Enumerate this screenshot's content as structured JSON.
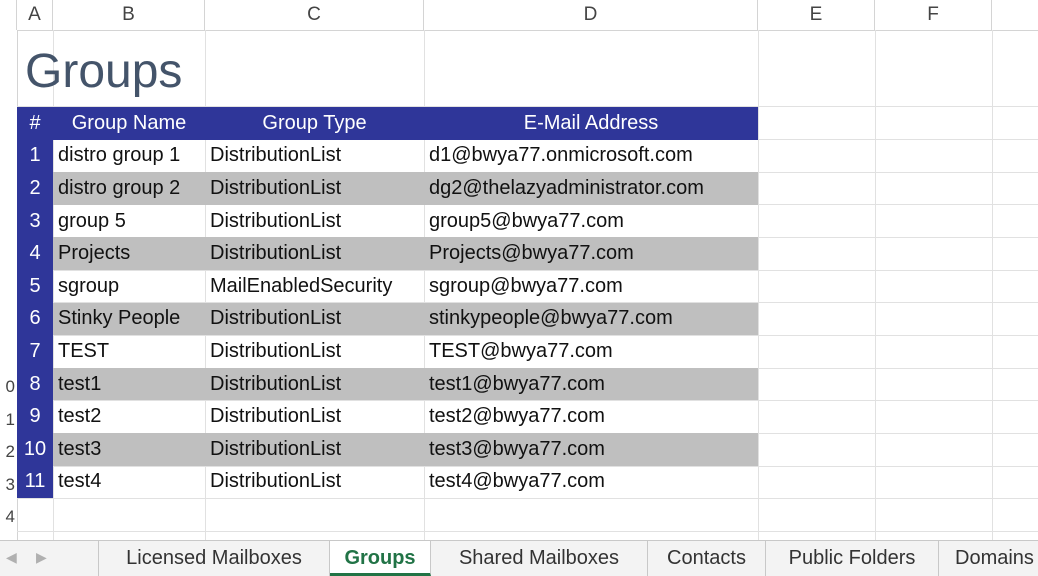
{
  "columns": [
    "A",
    "B",
    "C",
    "D",
    "E",
    "F"
  ],
  "row_numbers": [
    "",
    "",
    "",
    "",
    "",
    "",
    "",
    "",
    "",
    "0",
    "1",
    "2",
    "3",
    "4",
    ""
  ],
  "title": "Groups",
  "table": {
    "headers": {
      "num": "#",
      "name": "Group Name",
      "type": "Group Type",
      "mail": "E-Mail Address"
    },
    "rows": [
      {
        "num": "1",
        "name": "distro group 1",
        "type": "DistributionList",
        "mail": "d1@bwya77.onmicrosoft.com"
      },
      {
        "num": "2",
        "name": "distro group 2",
        "type": "DistributionList",
        "mail": "dg2@thelazyadministrator.com"
      },
      {
        "num": "3",
        "name": "group 5",
        "type": "DistributionList",
        "mail": "group5@bwya77.com"
      },
      {
        "num": "4",
        "name": "Projects",
        "type": "DistributionList",
        "mail": "Projects@bwya77.com"
      },
      {
        "num": "5",
        "name": "sgroup",
        "type": "MailEnabledSecurity",
        "mail": "sgroup@bwya77.com"
      },
      {
        "num": "6",
        "name": "Stinky People",
        "type": "DistributionList",
        "mail": "stinkypeople@bwya77.com"
      },
      {
        "num": "7",
        "name": "TEST",
        "type": "DistributionList",
        "mail": "TEST@bwya77.com"
      },
      {
        "num": "8",
        "name": "test1",
        "type": "DistributionList",
        "mail": "test1@bwya77.com"
      },
      {
        "num": "9",
        "name": "test2",
        "type": "DistributionList",
        "mail": "test2@bwya77.com"
      },
      {
        "num": "10",
        "name": "test3",
        "type": "DistributionList",
        "mail": "test3@bwya77.com"
      },
      {
        "num": "11",
        "name": "test4",
        "type": "DistributionList",
        "mail": "test4@bwya77.com"
      }
    ]
  },
  "tabs": {
    "licensed": "Licensed Mailboxes",
    "groups": "Groups",
    "shared": "Shared Mailboxes",
    "contacts": "Contacts",
    "public": "Public Folders",
    "domains": "Domains"
  },
  "colors": {
    "header_fill": "#2f3699",
    "shade_fill": "#bfbfbf",
    "active_tab": "#217346",
    "title": "#44546a"
  }
}
